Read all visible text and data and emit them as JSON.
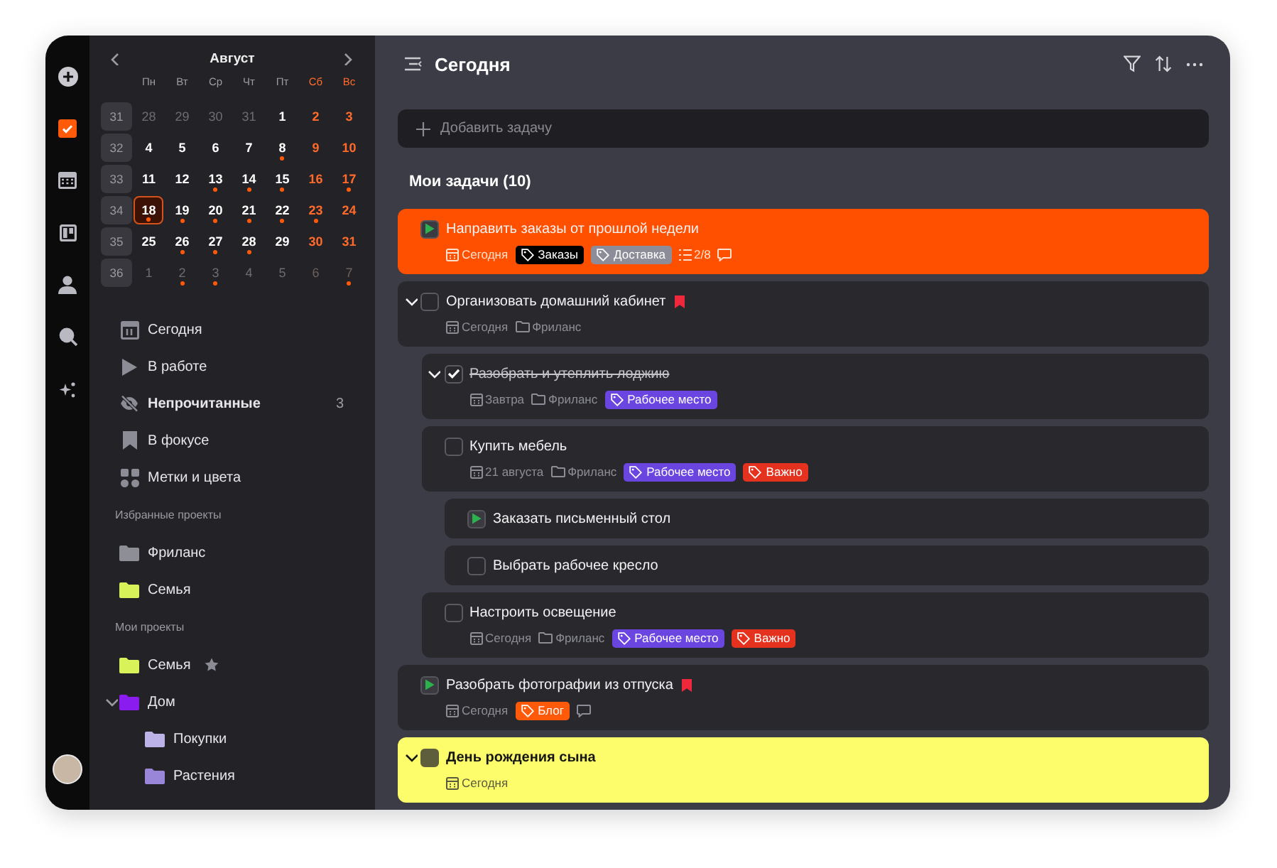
{
  "rail": {
    "items": [
      {
        "kind": "add",
        "selected": false
      },
      {
        "kind": "tasks",
        "selected": true
      },
      {
        "kind": "calendar",
        "selected": false
      },
      {
        "kind": "board",
        "selected": false
      },
      {
        "kind": "people",
        "selected": false
      },
      {
        "kind": "search",
        "selected": false
      },
      {
        "kind": "ai",
        "selected": false
      }
    ]
  },
  "calendar": {
    "month": "Август",
    "weekdays": [
      {
        "text": "Пн",
        "weekend": false
      },
      {
        "text": "Вт",
        "weekend": false
      },
      {
        "text": "Ср",
        "weekend": false
      },
      {
        "text": "Чт",
        "weekend": false
      },
      {
        "text": "Пт",
        "weekend": false
      },
      {
        "text": "Сб",
        "weekend": true
      },
      {
        "text": "Вс",
        "weekend": true
      }
    ],
    "weeks": [
      {
        "number": "31",
        "days": [
          {
            "text": "28",
            "other_month": true,
            "weekend": false,
            "event": false,
            "selected": false
          },
          {
            "text": "29",
            "other_month": true,
            "weekend": false,
            "event": false,
            "selected": false
          },
          {
            "text": "30",
            "other_month": true,
            "weekend": false,
            "event": false,
            "selected": false
          },
          {
            "text": "31",
            "other_month": true,
            "weekend": false,
            "event": false,
            "selected": false
          },
          {
            "text": "1",
            "other_month": false,
            "weekend": false,
            "event": false,
            "selected": false
          },
          {
            "text": "2",
            "other_month": false,
            "weekend": true,
            "event": false,
            "selected": false
          },
          {
            "text": "3",
            "other_month": false,
            "weekend": true,
            "event": false,
            "selected": false
          }
        ]
      },
      {
        "number": "32",
        "days": [
          {
            "text": "4",
            "other_month": false,
            "weekend": false,
            "event": false,
            "selected": false
          },
          {
            "text": "5",
            "other_month": false,
            "weekend": false,
            "event": false,
            "selected": false
          },
          {
            "text": "6",
            "other_month": false,
            "weekend": false,
            "event": false,
            "selected": false
          },
          {
            "text": "7",
            "other_month": false,
            "weekend": false,
            "event": false,
            "selected": false
          },
          {
            "text": "8",
            "other_month": false,
            "weekend": false,
            "event": true,
            "selected": false
          },
          {
            "text": "9",
            "other_month": false,
            "weekend": true,
            "event": false,
            "selected": false
          },
          {
            "text": "10",
            "other_month": false,
            "weekend": true,
            "event": false,
            "selected": false
          }
        ]
      },
      {
        "number": "33",
        "days": [
          {
            "text": "11",
            "other_month": false,
            "weekend": false,
            "event": false,
            "selected": false
          },
          {
            "text": "12",
            "other_month": false,
            "weekend": false,
            "event": false,
            "selected": false
          },
          {
            "text": "13",
            "other_month": false,
            "weekend": false,
            "event": true,
            "selected": false
          },
          {
            "text": "14",
            "other_month": false,
            "weekend": false,
            "event": true,
            "selected": false
          },
          {
            "text": "15",
            "other_month": false,
            "weekend": false,
            "event": true,
            "selected": false
          },
          {
            "text": "16",
            "other_month": false,
            "weekend": true,
            "event": false,
            "selected": false
          },
          {
            "text": "17",
            "other_month": false,
            "weekend": true,
            "event": true,
            "selected": false
          }
        ]
      },
      {
        "number": "34",
        "days": [
          {
            "text": "18",
            "other_month": false,
            "weekend": false,
            "event": true,
            "selected": true
          },
          {
            "text": "19",
            "other_month": false,
            "weekend": false,
            "event": true,
            "selected": false
          },
          {
            "text": "20",
            "other_month": false,
            "weekend": false,
            "event": true,
            "selected": false
          },
          {
            "text": "21",
            "other_month": false,
            "weekend": false,
            "event": true,
            "selected": false
          },
          {
            "text": "22",
            "other_month": false,
            "weekend": false,
            "event": true,
            "selected": false
          },
          {
            "text": "23",
            "other_month": false,
            "weekend": true,
            "event": true,
            "selected": false
          },
          {
            "text": "24",
            "other_month": false,
            "weekend": true,
            "event": false,
            "selected": false
          }
        ]
      },
      {
        "number": "35",
        "days": [
          {
            "text": "25",
            "other_month": false,
            "weekend": false,
            "event": false,
            "selected": false
          },
          {
            "text": "26",
            "other_month": false,
            "weekend": false,
            "event": true,
            "selected": false
          },
          {
            "text": "27",
            "other_month": false,
            "weekend": false,
            "event": true,
            "selected": false
          },
          {
            "text": "28",
            "other_month": false,
            "weekend": false,
            "event": true,
            "selected": false
          },
          {
            "text": "29",
            "other_month": false,
            "weekend": false,
            "event": false,
            "selected": false
          },
          {
            "text": "30",
            "other_month": false,
            "weekend": true,
            "event": false,
            "selected": false
          },
          {
            "text": "31",
            "other_month": false,
            "weekend": true,
            "event": false,
            "selected": false
          }
        ]
      },
      {
        "number": "36",
        "days": [
          {
            "text": "1",
            "other_month": true,
            "weekend": false,
            "event": false,
            "selected": false
          },
          {
            "text": "2",
            "other_month": true,
            "weekend": false,
            "event": true,
            "selected": false
          },
          {
            "text": "3",
            "other_month": true,
            "weekend": false,
            "event": true,
            "selected": false
          },
          {
            "text": "4",
            "other_month": true,
            "weekend": false,
            "event": false,
            "selected": false
          },
          {
            "text": "5",
            "other_month": true,
            "weekend": false,
            "event": false,
            "selected": false
          },
          {
            "text": "6",
            "other_month": true,
            "weekend": true,
            "event": false,
            "selected": false
          },
          {
            "text": "7",
            "other_month": true,
            "weekend": true,
            "event": true,
            "selected": false
          }
        ]
      }
    ]
  },
  "nav": [
    {
      "kind": "today",
      "label": "Сегодня",
      "unread": false
    },
    {
      "kind": "in_progress",
      "label": "В работе",
      "unread": false
    },
    {
      "kind": "unread",
      "label": "Непрочитанные",
      "unread": true,
      "count": "3"
    },
    {
      "kind": "focus",
      "label": "В фокусе",
      "unread": false
    },
    {
      "kind": "labels",
      "label": "Метки и цвета",
      "unread": false
    }
  ],
  "favorite_projects": {
    "title": "Избранные проекты",
    "items": [
      {
        "label": "Фриланс",
        "color": "#8e8e96"
      },
      {
        "label": "Семья",
        "color": "#d8f25a"
      }
    ]
  },
  "my_projects": {
    "title": "Мои проекты",
    "items": [
      {
        "label": "Семья",
        "color": "#d8f25a",
        "starred": true
      },
      {
        "label": "Дом",
        "color": "#8a1cf0",
        "starred": false,
        "expanded": true,
        "children": [
          {
            "label": "Покупки",
            "color": "#bdb3e6",
            "starred": false
          },
          {
            "label": "Растения",
            "color": "#9a86d8",
            "starred": false
          }
        ]
      }
    ]
  },
  "header": {
    "title": "Сегодня"
  },
  "add_task": {
    "placeholder": "Добавить задачу"
  },
  "section": {
    "title": "Мои задачи (10)"
  },
  "tasks": [
    {
      "title": "Направить заказы от прошлой недели",
      "checked": false,
      "started": true,
      "color": "#ff5000",
      "flag": false,
      "meta": [
        {
          "kind": "date",
          "text": "Сегодня"
        },
        {
          "kind": "tag",
          "text": "Заказы",
          "color": "#000000"
        },
        {
          "kind": "tag",
          "text": "Доставка",
          "color": "#8d8d99"
        },
        {
          "kind": "subtasks",
          "text": "2/8"
        },
        {
          "kind": "comment"
        }
      ]
    },
    {
      "title": "Организовать домашний кабинет",
      "checked": false,
      "started": false,
      "flag": true,
      "expanded": true,
      "meta": [
        {
          "kind": "date",
          "text": "Сегодня"
        },
        {
          "kind": "project",
          "text": "Фриланс"
        }
      ],
      "children": [
        {
          "title": "Разобрать и утеплить лоджию",
          "checked": true,
          "flag": false,
          "expanded": true,
          "meta": [
            {
              "kind": "date",
              "text": "Завтра"
            },
            {
              "kind": "project",
              "text": "Фриланс"
            },
            {
              "kind": "tag",
              "text": "Рабочее место",
              "color": "#6b45e0"
            }
          ]
        },
        {
          "title": "Купить мебель",
          "checked": false,
          "started": false,
          "flag": false,
          "meta": [
            {
              "kind": "date",
              "text": "21 августа"
            },
            {
              "kind": "project",
              "text": "Фриланс"
            },
            {
              "kind": "tag",
              "text": "Рабочее место",
              "color": "#6b45e0"
            },
            {
              "kind": "tag",
              "text": "Важно",
              "color": "#e5321e"
            }
          ],
          "children": [
            {
              "title": "Заказать письменный стол",
              "checked": false,
              "started": true,
              "flag": false
            },
            {
              "title": "Выбрать рабочее кресло",
              "checked": false,
              "started": false,
              "flag": false
            }
          ]
        },
        {
          "title": "Настроить освещение",
          "checked": false,
          "started": false,
          "flag": false,
          "meta": [
            {
              "kind": "date",
              "text": "Сегодня"
            },
            {
              "kind": "project",
              "text": "Фриланс"
            },
            {
              "kind": "tag",
              "text": "Рабочее место",
              "color": "#6b45e0"
            },
            {
              "kind": "tag",
              "text": "Важно",
              "color": "#e5321e"
            }
          ]
        }
      ]
    },
    {
      "title": "Разобрать фотографии из отпуска",
      "checked": false,
      "started": true,
      "flag": true,
      "meta": [
        {
          "kind": "date",
          "text": "Сегодня"
        },
        {
          "kind": "tag",
          "text": "Блог",
          "color": "#ff5a0a"
        },
        {
          "kind": "comment"
        }
      ]
    },
    {
      "title": "День рождения сына",
      "checked": false,
      "started": false,
      "color": "#fdfd6c",
      "flag": false,
      "expanded": true,
      "meta": [
        {
          "kind": "date",
          "text": "Сегодня"
        }
      ]
    }
  ]
}
